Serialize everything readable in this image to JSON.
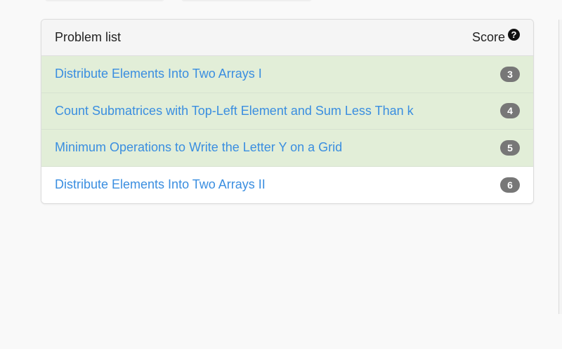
{
  "panel": {
    "title": "Problem list",
    "score_label": "Score",
    "help_icon_glyph": "?"
  },
  "problems": [
    {
      "name": "Distribute Elements Into Two Arrays I",
      "score": "3",
      "status": "solved"
    },
    {
      "name": "Count Submatrices with Top-Left Element and Sum Less Than k",
      "score": "4",
      "status": "solved"
    },
    {
      "name": "Minimum Operations to Write the Letter Y on a Grid",
      "score": "5",
      "status": "solved"
    },
    {
      "name": "Distribute Elements Into Two Arrays II",
      "score": "6",
      "status": "unsolved"
    }
  ],
  "colors": {
    "link": "#3a8ee0",
    "solved_row": "#e2eed8",
    "badge": "#777777"
  }
}
